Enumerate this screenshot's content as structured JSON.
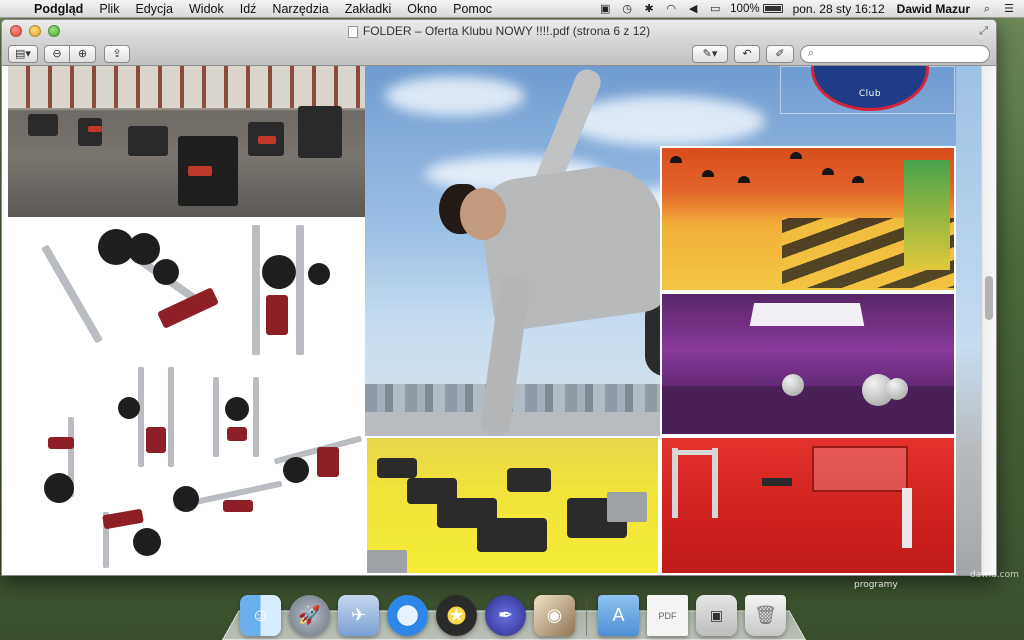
{
  "menubar": {
    "apple_glyph": "",
    "items": [
      "Podgląd",
      "Plik",
      "Edycja",
      "Widok",
      "Idź",
      "Narzędzia",
      "Zakładki",
      "Okno",
      "Pomoc"
    ],
    "battery_percent": "100%",
    "battery_level": 1.0,
    "datetime": "pon. 28 sty  16:12",
    "user": "Dawid Mazur"
  },
  "window": {
    "title": "FOLDER – Oferta Klubu NOWY !!!!.pdf (strona 6 z 12)",
    "search_placeholder": ""
  },
  "document": {
    "logo_text": "Club"
  },
  "desktop": {
    "label": "programy",
    "label2": "dawid.com"
  },
  "dock": {
    "pdf_label": "PDF"
  },
  "colors": {
    "red_room": "#d2231f",
    "purple_room": "#6b2c7e",
    "yellow_room": "#f2e33b",
    "logo_blue": "#1f3c86",
    "logo_red": "#d6253a"
  }
}
